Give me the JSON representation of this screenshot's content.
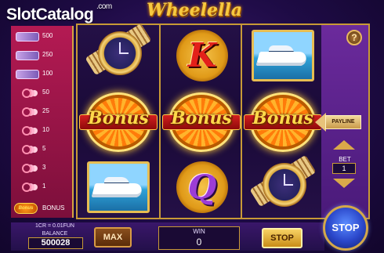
{
  "brand": {
    "part1": "Slot",
    "part2": "Catalog",
    "suffix": ".com"
  },
  "game_title": "Wheelella",
  "paytable": {
    "rows": [
      {
        "icon": "watch-icon",
        "value": "500"
      },
      {
        "icon": "yacht-icon",
        "value": "250"
      },
      {
        "icon": "car-icon",
        "value": "100"
      },
      {
        "icon": "ring-icon",
        "value": "50"
      },
      {
        "icon": "ring-icon",
        "value": "25"
      },
      {
        "icon": "ring-icon",
        "value": "10"
      },
      {
        "icon": "ring-icon",
        "value": "5"
      },
      {
        "icon": "ring-icon",
        "value": "3"
      },
      {
        "icon": "ring-icon",
        "value": "1"
      }
    ],
    "bonus_icon_text": "Bonus",
    "bonus_label": "BONUS"
  },
  "reels": [
    [
      {
        "type": "watch"
      },
      {
        "type": "bonus",
        "text": "Bonus"
      },
      {
        "type": "yacht"
      }
    ],
    [
      {
        "type": "letter",
        "text": "K"
      },
      {
        "type": "bonus",
        "text": "Bonus"
      },
      {
        "type": "letter",
        "text": "Q"
      }
    ],
    [
      {
        "type": "yacht"
      },
      {
        "type": "bonus",
        "text": "Bonus"
      },
      {
        "type": "watch"
      }
    ]
  ],
  "right_panel": {
    "help_label": "?",
    "payline_label": "PAYLINE",
    "bet_label": "BET",
    "bet_value": "1"
  },
  "bottom": {
    "cr_rate": "1CR = 0.01FUN",
    "balance_label": "BALANCE",
    "balance_value": "500028",
    "max_label": "MAX",
    "win_label": "WIN",
    "win_value": "0",
    "stop_small_label": "STOP",
    "stop_big_label": "STOP"
  },
  "colors": {
    "gold": "#c89a36",
    "paytable_bg": "#b41a53",
    "spin_button": "#2a46c9"
  }
}
